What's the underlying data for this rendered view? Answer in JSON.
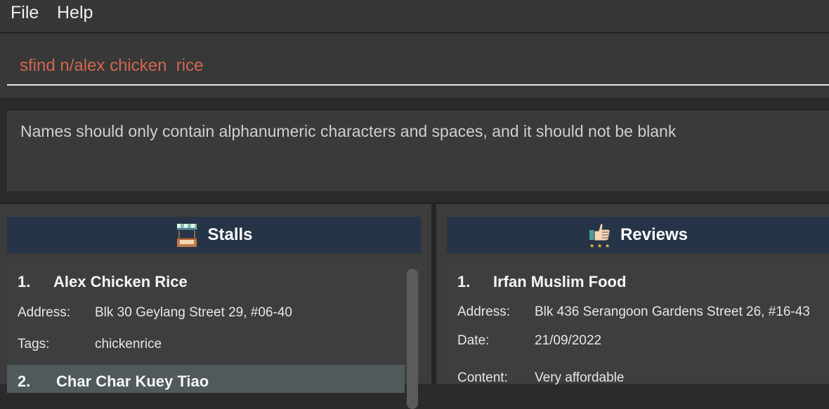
{
  "menu": {
    "file": "File",
    "help": "Help"
  },
  "command": {
    "value": "sfind n/alex chicken  rice"
  },
  "result": {
    "message": "Names should only contain alphanumeric characters and spaces, and it should not be blank"
  },
  "stalls": {
    "header": "Stalls",
    "items": [
      {
        "index": "1.",
        "name": "Alex Chicken Rice",
        "address_label": "Address:",
        "address": "Blk 30 Geylang Street 29, #06-40",
        "tags_label": "Tags:",
        "tags": "chickenrice"
      },
      {
        "index": "2.",
        "name": "Char Char Kuey Tiao"
      }
    ]
  },
  "reviews": {
    "header": "Reviews",
    "items": [
      {
        "index": "1.",
        "name": "Irfan Muslim Food",
        "address_label": "Address:",
        "address": "Blk 436 Serangoon Gardens Street 26, #16-43",
        "date_label": "Date:",
        "date": "21/09/2022",
        "content_label": "Content:",
        "content": "Very affordable"
      }
    ]
  }
}
